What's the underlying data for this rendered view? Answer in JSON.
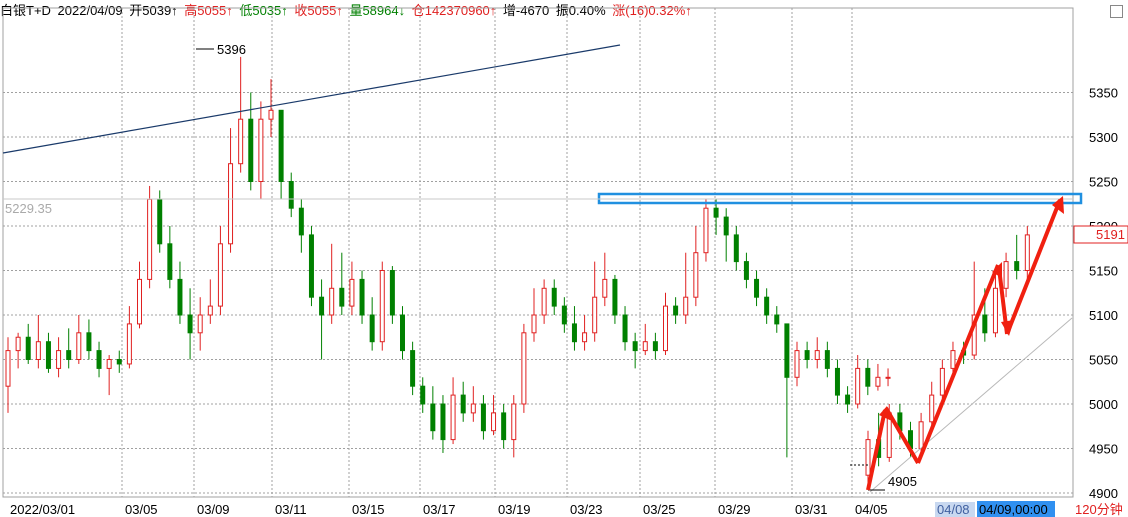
{
  "header": {
    "symbol": "白银T+D",
    "date": "2022/04/09",
    "open": "开5039↑",
    "high": "高5055↑",
    "low": "低5035↑",
    "close": "收5055↑",
    "volume": "量58964↓",
    "position": "仓142370960↑",
    "change_pos": "增-4670",
    "amplitude": "振0.40%",
    "rise": "涨(16)0.32%↑"
  },
  "colors": {
    "up": "#e02020",
    "down": "#008000",
    "grid": "#a0a0a0",
    "box": "#2090e0",
    "trend": "#1a3a6a",
    "arrow": "#f02010",
    "cursor": "#80c0ff"
  },
  "chart_data": {
    "type": "candlestick",
    "y_range": [
      4900,
      5400
    ],
    "y_ticks": [
      4900,
      4950,
      5000,
      5050,
      5100,
      5150,
      5200,
      5250,
      5300,
      5350
    ],
    "x_ticks": [
      "2022/03/01",
      "03/05",
      "03/09",
      "03/11",
      "03/15",
      "03/17",
      "03/19",
      "03/23",
      "03/25",
      "03/29",
      "03/31",
      "04/05",
      "04/08",
      "04/09,00:00"
    ],
    "period": "120分钟",
    "annotations": {
      "high": "5396",
      "low": "4905",
      "left_price": "5229.35",
      "last_price": "5191"
    },
    "candles": [
      [
        5020,
        5060,
        4990,
        5075
      ],
      [
        5060,
        5075,
        5040,
        5080
      ],
      [
        5075,
        5050,
        5045,
        5090
      ],
      [
        5050,
        5070,
        5040,
        5100
      ],
      [
        5070,
        5040,
        5035,
        5080
      ],
      [
        5040,
        5060,
        5030,
        5075
      ],
      [
        5060,
        5050,
        5040,
        5085
      ],
      [
        5050,
        5080,
        5045,
        5100
      ],
      [
        5080,
        5060,
        5050,
        5095
      ],
      [
        5060,
        5040,
        5030,
        5070
      ],
      [
        5040,
        5050,
        5010,
        5055
      ],
      [
        5050,
        5045,
        5035,
        5060
      ],
      [
        5045,
        5090,
        5040,
        5110
      ],
      [
        5090,
        5140,
        5085,
        5160
      ],
      [
        5140,
        5230,
        5130,
        5245
      ],
      [
        5230,
        5180,
        5170,
        5240
      ],
      [
        5180,
        5140,
        5130,
        5200
      ],
      [
        5140,
        5100,
        5090,
        5160
      ],
      [
        5100,
        5080,
        5050,
        5130
      ],
      [
        5080,
        5100,
        5060,
        5120
      ],
      [
        5100,
        5110,
        5090,
        5140
      ],
      [
        5110,
        5180,
        5100,
        5200
      ],
      [
        5180,
        5270,
        5170,
        5310
      ],
      [
        5270,
        5320,
        5260,
        5390
      ],
      [
        5320,
        5250,
        5240,
        5350
      ],
      [
        5250,
        5320,
        5230,
        5340
      ],
      [
        5320,
        5330,
        5300,
        5365
      ],
      [
        5330,
        5250,
        5230,
        5330
      ],
      [
        5250,
        5220,
        5210,
        5260
      ],
      [
        5220,
        5190,
        5170,
        5230
      ],
      [
        5190,
        5120,
        5110,
        5200
      ],
      [
        5120,
        5100,
        5050,
        5140
      ],
      [
        5100,
        5130,
        5090,
        5180
      ],
      [
        5130,
        5110,
        5100,
        5170
      ],
      [
        5110,
        5140,
        5100,
        5160
      ],
      [
        5140,
        5100,
        5090,
        5150
      ],
      [
        5100,
        5070,
        5060,
        5120
      ],
      [
        5070,
        5150,
        5060,
        5160
      ],
      [
        5150,
        5100,
        5090,
        5155
      ],
      [
        5100,
        5060,
        5050,
        5110
      ],
      [
        5060,
        5020,
        5010,
        5070
      ],
      [
        5020,
        5000,
        4990,
        5030
      ],
      [
        5000,
        4970,
        4960,
        5020
      ],
      [
        5000,
        4960,
        4945,
        5010
      ],
      [
        4960,
        5010,
        4955,
        5030
      ],
      [
        5010,
        4990,
        4980,
        5025
      ],
      [
        4990,
        5000,
        4980,
        5020
      ],
      [
        5000,
        4970,
        4960,
        5010
      ],
      [
        4970,
        4990,
        4965,
        5010
      ],
      [
        4990,
        4960,
        4950,
        5000
      ],
      [
        4960,
        5000,
        4940,
        5010
      ],
      [
        5000,
        5080,
        4990,
        5090
      ],
      [
        5080,
        5100,
        5070,
        5130
      ],
      [
        5100,
        5130,
        5090,
        5140
      ],
      [
        5130,
        5110,
        5100,
        5140
      ],
      [
        5110,
        5090,
        5080,
        5120
      ],
      [
        5090,
        5070,
        5060,
        5110
      ],
      [
        5070,
        5080,
        5060,
        5100
      ],
      [
        5080,
        5120,
        5070,
        5160
      ],
      [
        5120,
        5140,
        5110,
        5170
      ],
      [
        5140,
        5100,
        5090,
        5145
      ],
      [
        5100,
        5070,
        5060,
        5110
      ],
      [
        5070,
        5060,
        5040,
        5080
      ],
      [
        5060,
        5070,
        5055,
        5090
      ],
      [
        5070,
        5060,
        5050,
        5080
      ],
      [
        5060,
        5110,
        5055,
        5125
      ],
      [
        5110,
        5100,
        5090,
        5120
      ],
      [
        5100,
        5120,
        5090,
        5170
      ],
      [
        5120,
        5170,
        5110,
        5200
      ],
      [
        5170,
        5220,
        5160,
        5230
      ],
      [
        5220,
        5210,
        5190,
        5230
      ],
      [
        5210,
        5190,
        5160,
        5220
      ],
      [
        5190,
        5160,
        5150,
        5200
      ],
      [
        5160,
        5140,
        5130,
        5170
      ],
      [
        5140,
        5120,
        5110,
        5150
      ],
      [
        5120,
        5100,
        5090,
        5130
      ],
      [
        5100,
        5090,
        5080,
        5110
      ],
      [
        5090,
        5030,
        4940,
        5090
      ],
      [
        5030,
        5060,
        5020,
        5070
      ],
      [
        5060,
        5050,
        5040,
        5070
      ],
      [
        5050,
        5060,
        5040,
        5075
      ],
      [
        5060,
        5040,
        5030,
        5070
      ],
      [
        5040,
        5010,
        5000,
        5050
      ],
      [
        5010,
        5000,
        4990,
        5020
      ],
      [
        5000,
        5040,
        4995,
        5055
      ],
      [
        5040,
        5020,
        5010,
        5050
      ],
      [
        5020,
        5030,
        5015,
        5045
      ],
      [
        5030,
        5030,
        5020,
        5040
      ],
      [
        4920,
        4960,
        4905,
        4970
      ],
      [
        4960,
        4940,
        4930,
        4990
      ],
      [
        4940,
        4990,
        4935,
        5000
      ],
      [
        4990,
        4970,
        4960,
        5000
      ],
      [
        4970,
        4950,
        4940,
        4980
      ],
      [
        4950,
        4980,
        4945,
        4990
      ],
      [
        4980,
        5010,
        4970,
        5025
      ],
      [
        5010,
        5040,
        5000,
        5050
      ],
      [
        5040,
        5060,
        5030,
        5070
      ],
      [
        5060,
        5055,
        5045,
        5070
      ],
      [
        5055,
        5100,
        5050,
        5160
      ],
      [
        5100,
        5080,
        5070,
        5130
      ],
      [
        5080,
        5130,
        5075,
        5150
      ],
      [
        5130,
        5160,
        5120,
        5170
      ],
      [
        5160,
        5150,
        5140,
        5190
      ],
      [
        5150,
        5190,
        5140,
        5200
      ]
    ]
  }
}
